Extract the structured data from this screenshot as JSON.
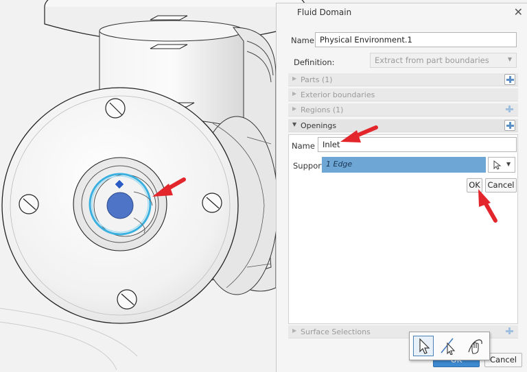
{
  "dialog": {
    "title": "Fluid Domain",
    "name_label": "Name",
    "name_value": "Physical Environment.1",
    "definition_label": "Definition:",
    "definition_value": "Extract from part boundaries",
    "sections": {
      "parts": "Parts (1)",
      "exterior": "Exterior boundaries",
      "regions": "Regions (1)",
      "openings": "Openings",
      "surface": "Surface Selections"
    },
    "opening": {
      "name_label": "Name",
      "name_value": "Inlet",
      "support_label": "Support",
      "support_value": "1 Edge",
      "ok_label": "OK",
      "cancel_label": "Cancel"
    },
    "footer": {
      "ok_label": "OK",
      "cancel_label": "Cancel"
    }
  },
  "colors": {
    "selection_blue": "#6ea6d6",
    "highlight_edge": "#3ab0e0",
    "annotation_red": "#e3262b",
    "ok_button": "#3e8ad0"
  },
  "icons": [
    "close-icon",
    "plus-icon",
    "pointer-icon",
    "edge-select-icon",
    "hand-select-icon",
    "chevron-down-icon"
  ]
}
